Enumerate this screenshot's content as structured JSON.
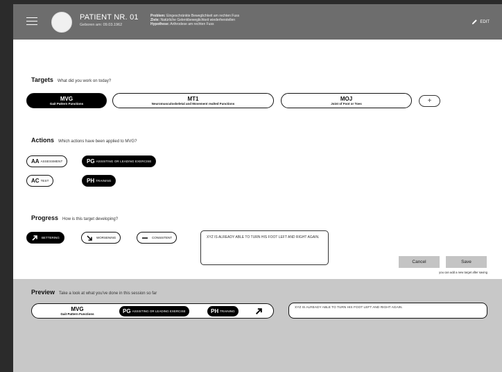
{
  "header": {
    "patient_name": "PATIENT NR. 01",
    "birth": "Geboren am: 09.03.1962",
    "problem_label": "Problem:",
    "problem": "Eingeschränkte Beweglichkeit am rechten Fuss",
    "goals_label": "Ziele:",
    "goals": "Natürliche Gelenkbeweglichkeit wiederherstellen",
    "hypothesis_label": "Hypothese:",
    "hypothesis": "Arthrodese am rechten Fuss",
    "edit_label": "EDIT",
    "icons": {
      "menu": "hamburger-menu-icon",
      "edit": "pencil-icon"
    }
  },
  "targets": {
    "title": "Targets",
    "question": "What did you work on today?",
    "items": [
      {
        "code": "MVG",
        "desc": "Gait Pattern Functions",
        "active": true
      },
      {
        "code": "MT1",
        "desc": "Neuromusculoskeletal and Movement realted Functions",
        "active": false
      },
      {
        "code": "MOJ",
        "desc": "Joint of Foot or Toes",
        "active": false
      }
    ],
    "add_label": "+"
  },
  "actions": {
    "title": "Actions",
    "question": "Which actions have been applied to MVG?",
    "items": [
      {
        "code": "AA",
        "desc": "ASSESSMENT",
        "active": false
      },
      {
        "code": "PG",
        "desc": "ASSISTING OR LEADING EXERCISE",
        "active": true
      },
      {
        "code": "AC",
        "desc": "TEST",
        "active": false
      },
      {
        "code": "PH",
        "desc": "TRAINING",
        "active": true
      }
    ]
  },
  "progress": {
    "title": "Progress",
    "question": "How is this target developing?",
    "options": [
      {
        "label": "BETTERING",
        "icon": "arrow-up-right-icon",
        "active": true
      },
      {
        "label": "WORSENING",
        "icon": "arrow-down-right-icon",
        "active": false
      },
      {
        "label": "CONSISTENT",
        "icon": "dash-icon",
        "active": false
      }
    ],
    "note": "XYZ IS ALREADY ABLE TO TURN HIS FOOT LEFT AND RIGHT AGAIN.",
    "cancel_label": "Cancel",
    "save_label": "Save",
    "hint": "you can add a new target after saving"
  },
  "preview": {
    "title": "Preview",
    "subtitle": "Take a look at what you've done in this session so far",
    "target_code": "MVG",
    "target_desc": "Gait Pattern Functions",
    "actions": [
      {
        "code": "PG",
        "desc": "ASSISTING OR LEADING EXERCISE"
      },
      {
        "code": "PH",
        "desc": "TRAINING"
      }
    ],
    "progress_icon": "arrow-up-right-icon",
    "note": "XYZ IS ALREADY ABLE TO TURN HIS FOOT LEFT AND RIGHT AGAIN."
  },
  "colors": {
    "header_bg": "#6d6d6d",
    "active_bg": "#000000",
    "preview_bg": "#c8c8c8",
    "button_bg": "#c4c4c4",
    "outer_bg": "#2b2b2b"
  }
}
